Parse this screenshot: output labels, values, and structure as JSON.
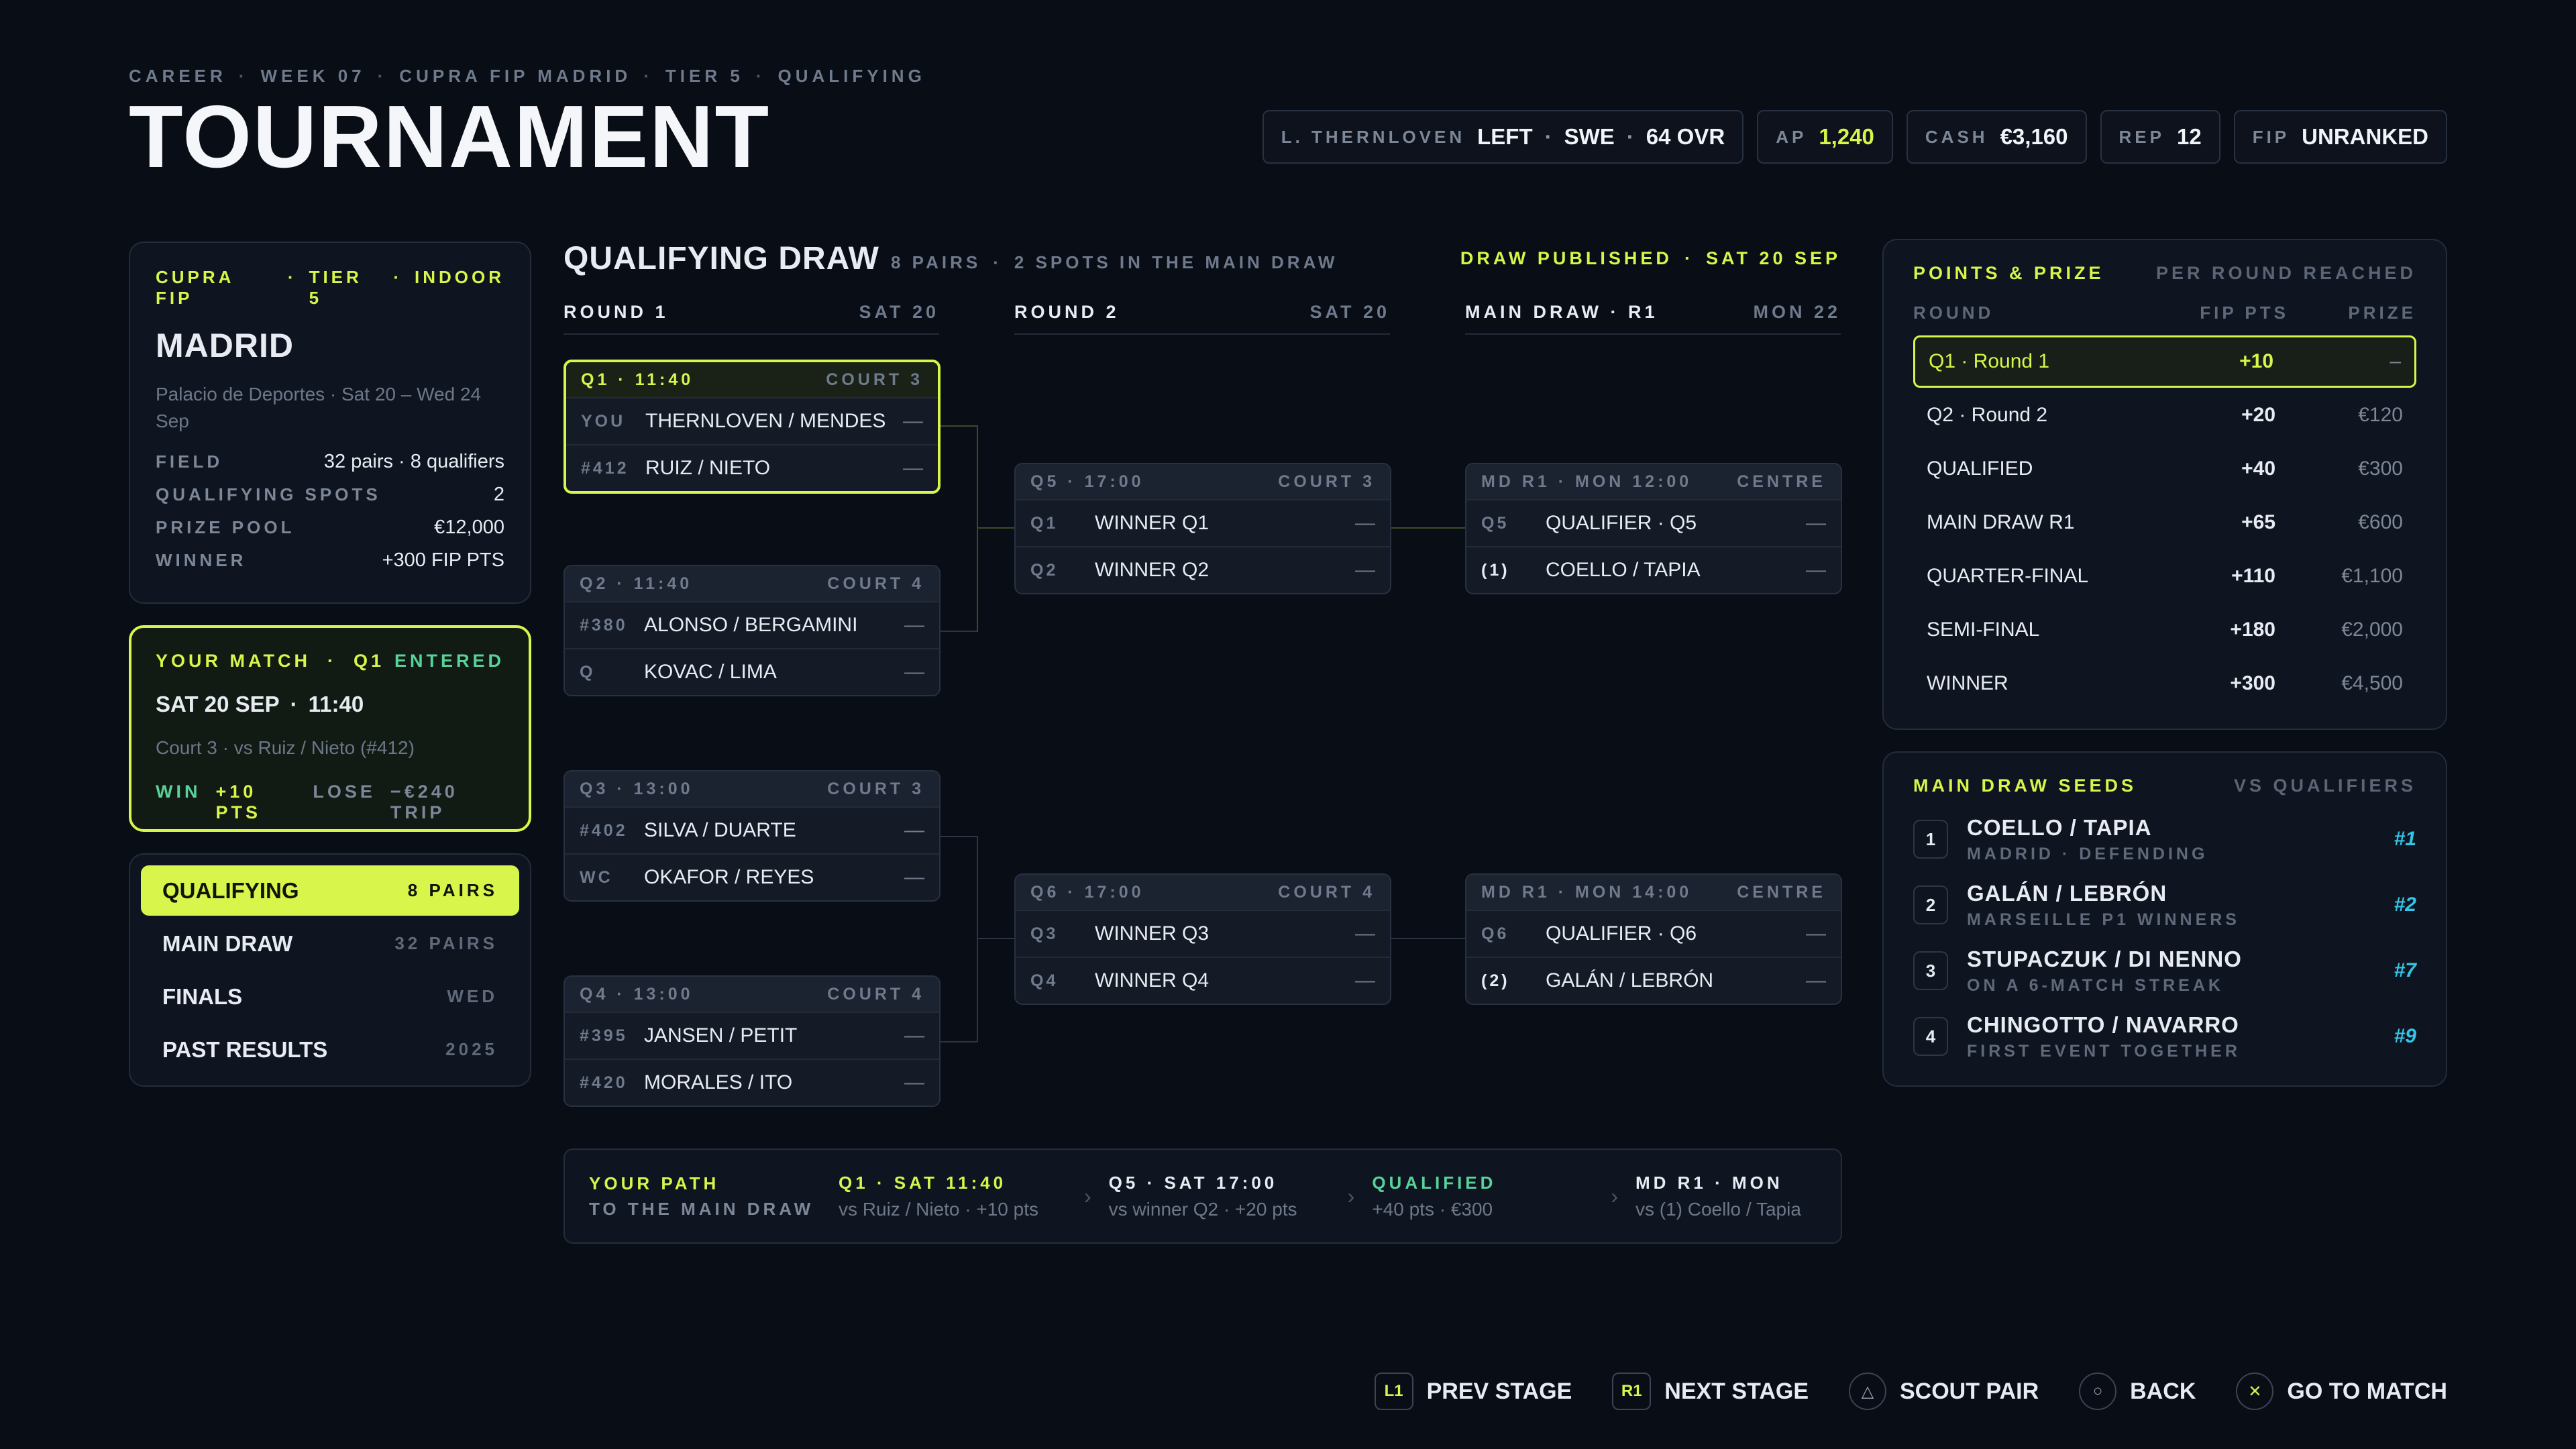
{
  "header": {
    "crumbs": [
      "CAREER",
      "WEEK 07",
      "CUPRA FIP MADRID",
      "TIER 5",
      "QUALIFYING"
    ],
    "title": "TOURNAMENT",
    "player": {
      "label": "L. THERNLOVEN",
      "side": "LEFT",
      "nation": "SWE",
      "ovr": "64 OVR"
    },
    "stats": [
      {
        "key": "AP",
        "value": "1,240"
      },
      {
        "key": "CASH",
        "value": "€3,160"
      },
      {
        "key": "REP",
        "value": "12"
      },
      {
        "key": "FIP",
        "value": "UNRANKED"
      }
    ]
  },
  "event": {
    "tag": [
      "CUPRA FIP",
      "TIER 5",
      "INDOOR"
    ],
    "city": "MADRID",
    "venue": "Palacio de Deportes · Sat 20 – Wed 24 Sep",
    "rows": [
      {
        "k": "FIELD",
        "v": "32 pairs · 8 qualifiers"
      },
      {
        "k": "QUALIFYING SPOTS",
        "v": "2"
      },
      {
        "k": "PRIZE POOL",
        "v": "€12,000"
      },
      {
        "k": "WINNER",
        "v": "+300 FIP PTS"
      }
    ]
  },
  "your_match": {
    "label": "YOUR MATCH",
    "match": "Q1",
    "status": "ENTERED",
    "date": "SAT 20 SEP",
    "time": "11:40",
    "detail": "Court 3 · vs Ruiz / Nieto (#412)",
    "win": "WIN",
    "win_value": "+10 PTS",
    "lose": "LOSE",
    "lose_value": "−€240 TRIP"
  },
  "stages": [
    {
      "name": "QUALIFYING",
      "meta": "8 PAIRS",
      "active": true
    },
    {
      "name": "MAIN DRAW",
      "meta": "32 PAIRS",
      "active": false
    },
    {
      "name": "FINALS",
      "meta": "WED",
      "active": false
    },
    {
      "name": "PAST RESULTS",
      "meta": "2025",
      "active": false
    }
  ],
  "bracket": {
    "title": "QUALIFYING DRAW",
    "sub": [
      "8 PAIRS",
      "2 SPOTS IN THE MAIN DRAW"
    ],
    "published": "DRAW PUBLISHED",
    "published_date": "SAT 20 SEP",
    "columns": [
      {
        "left": "ROUND 1",
        "right": "SAT 20"
      },
      {
        "left": "ROUND 2",
        "right": "SAT 20"
      },
      {
        "left": "MAIN DRAW · R1",
        "right": "MON 22"
      }
    ],
    "matches": [
      {
        "head": "Q1 · 11:40",
        "court": "COURT 3",
        "p1seed": "YOU",
        "p1": "THERNLOVEN / MENDES",
        "p1score": "—",
        "p2seed": "#412",
        "p2": "RUIZ / NIETO",
        "p2score": "—"
      },
      {
        "head": "Q2 · 11:40",
        "court": "COURT 4",
        "p1seed": "#380",
        "p1": "ALONSO / BERGAMINI",
        "p1score": "—",
        "p2seed": "Q",
        "p2": "KOVAC / LIMA",
        "p2score": "—"
      },
      {
        "head": "Q3 · 13:00",
        "court": "COURT 3",
        "p1seed": "#402",
        "p1": "SILVA / DUARTE",
        "p1score": "—",
        "p2seed": "WC",
        "p2": "OKAFOR / REYES",
        "p2score": "—"
      },
      {
        "head": "Q4 · 13:00",
        "court": "COURT 4",
        "p1seed": "#395",
        "p1": "JANSEN / PETIT",
        "p1score": "—",
        "p2seed": "#420",
        "p2": "MORALES / ITO",
        "p2score": "—"
      },
      {
        "head": "Q5 · 17:00",
        "court": "COURT 3",
        "p1seed": "Q1",
        "p1": "WINNER Q1",
        "p1score": "—",
        "p2seed": "Q2",
        "p2": "WINNER Q2",
        "p2score": "—"
      },
      {
        "head": "Q6 · 17:00",
        "court": "COURT 4",
        "p1seed": "Q3",
        "p1": "WINNER Q3",
        "p1score": "—",
        "p2seed": "Q4",
        "p2": "WINNER Q4",
        "p2score": "—"
      },
      {
        "head": "MD R1 · MON 12:00",
        "court": "CENTRE",
        "p1seed": "Q5",
        "p1": "QUALIFIER · Q5",
        "p1score": "—",
        "p2seed": "(1)",
        "p2": "COELLO / TAPIA",
        "p2score": "—"
      },
      {
        "head": "MD R1 · MON 14:00",
        "court": "CENTRE",
        "p1seed": "Q6",
        "p1": "QUALIFIER · Q6",
        "p1score": "—",
        "p2seed": "(2)",
        "p2": "GALÁN / LEBRÓN",
        "p2score": "—"
      }
    ]
  },
  "path": {
    "label1": "YOUR PATH",
    "label2": "TO THE MAIN DRAW",
    "steps": [
      {
        "a": "Q1 · SAT 11:40",
        "b": "vs Ruiz / Nieto · +10 pts"
      },
      {
        "a": "Q5 · SAT 17:00",
        "b": "vs winner Q2 · +20 pts"
      },
      {
        "a": "QUALIFIED",
        "b": "+40 pts · €300"
      },
      {
        "a": "MD R1 · MON",
        "b": "vs (1) Coello / Tapia"
      }
    ]
  },
  "points": {
    "title": "POINTS & PRIZE",
    "note": "PER ROUND REACHED",
    "cols": [
      "ROUND",
      "FIP PTS",
      "PRIZE"
    ],
    "rows": [
      {
        "round": "Q1 · Round 1",
        "pts": "+10",
        "prize": "–",
        "current": true
      },
      {
        "round": "Q2 · Round 2",
        "pts": "+20",
        "prize": "€120",
        "current": false
      },
      {
        "round": "QUALIFIED",
        "pts": "+40",
        "prize": "€300",
        "current": false
      },
      {
        "round": "MAIN DRAW R1",
        "pts": "+65",
        "prize": "€600",
        "current": false
      },
      {
        "round": "QUARTER-FINAL",
        "pts": "+110",
        "prize": "€1,100",
        "current": false
      },
      {
        "round": "SEMI-FINAL",
        "pts": "+180",
        "prize": "€2,000",
        "current": false
      },
      {
        "round": "WINNER",
        "pts": "+300",
        "prize": "€4,500",
        "current": false
      }
    ]
  },
  "seeds": {
    "title": "MAIN DRAW SEEDS",
    "note": "VS QUALIFIERS",
    "rows": [
      {
        "num": "1",
        "name": "COELLO / TAPIA",
        "note": "MADRID · DEFENDING",
        "rank": "#1"
      },
      {
        "num": "2",
        "name": "GALÁN / LEBRÓN",
        "note": "MARSEILLE P1 WINNERS",
        "rank": "#2"
      },
      {
        "num": "3",
        "name": "STUPACZUK / DI NENNO",
        "note": "ON A 6-MATCH STREAK",
        "rank": "#7"
      },
      {
        "num": "4",
        "name": "CHINGOTTO / NAVARRO",
        "note": "FIRST EVENT TOGETHER",
        "rank": "#9"
      }
    ]
  },
  "footer": [
    {
      "key": "L1",
      "label": "PREV STAGE",
      "icon": "l1-button-icon"
    },
    {
      "key": "R1",
      "label": "NEXT STAGE",
      "icon": "r1-button-icon"
    },
    {
      "key": "△",
      "label": "SCOUT PAIR",
      "icon": "triangle-button-icon"
    },
    {
      "key": "○",
      "label": "BACK",
      "icon": "circle-button-icon"
    },
    {
      "key": "✕",
      "label": "GO TO MATCH",
      "icon": "cross-button-icon"
    }
  ],
  "colors": {
    "accent": "#d7f54a",
    "qualified": "#57d39a",
    "wildcard": "#33c6e8",
    "background": "#090d16"
  }
}
